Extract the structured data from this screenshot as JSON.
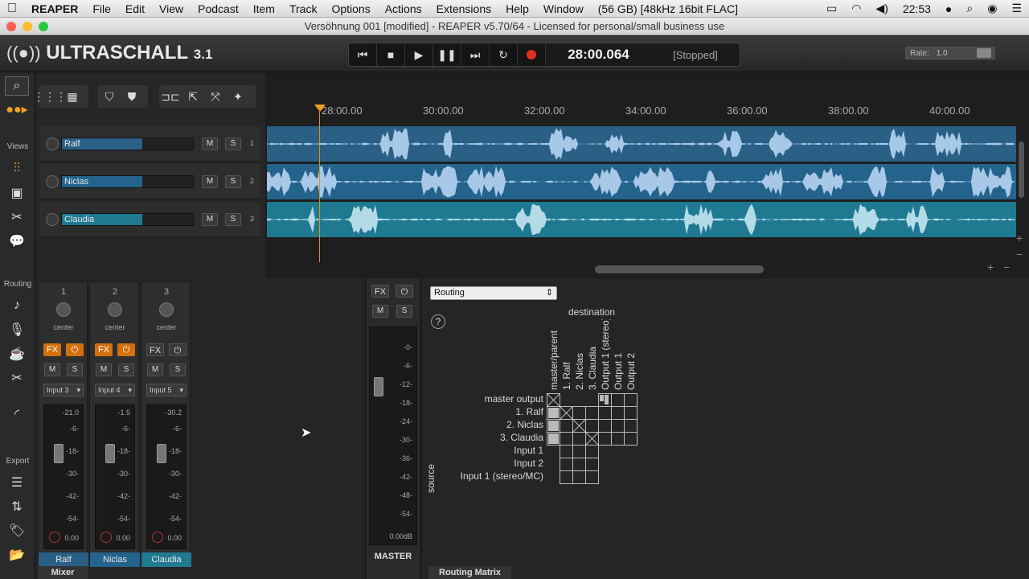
{
  "menubar": {
    "apple": "",
    "app": "REAPER",
    "items": [
      "File",
      "Edit",
      "View",
      "Podcast",
      "Item",
      "Track",
      "Options",
      "Actions",
      "Extensions",
      "Help",
      "Window"
    ],
    "status": "(56 GB) [48kHz 16bit FLAC]",
    "clock": "22:53"
  },
  "window": {
    "title": "Versöhnung 001 [modified] - REAPER v5.70/64 - Licensed for personal/small business use"
  },
  "header": {
    "logo": "ULTRASCHALL",
    "version": "3.1",
    "time": "28:00.064",
    "status": "[Stopped]",
    "rate_label": "Rate:",
    "rate_value": "1.0"
  },
  "leftbar": {
    "views": "Views",
    "routing": "Routing",
    "export": "Export"
  },
  "tracks": [
    {
      "name": "Ralf",
      "num": "1",
      "color": "#2a5f86"
    },
    {
      "name": "Niclas",
      "num": "2",
      "color": "#23638c"
    },
    {
      "name": "Claudia",
      "num": "3",
      "color": "#1f7a91"
    }
  ],
  "track_buttons": {
    "mute": "M",
    "solo": "S"
  },
  "ruler": {
    "ticks": [
      "28:00.00",
      "30:00.00",
      "32:00.00",
      "34:00.00",
      "36:00.00",
      "38:00.00",
      "40:00.00"
    ]
  },
  "mixer": {
    "tab": "Mixer",
    "strips": [
      {
        "num": "1",
        "pan": "center",
        "input": "Input 3",
        "peak": "-21.0",
        "vol": "0.00",
        "name": "Ralf"
      },
      {
        "num": "2",
        "pan": "center",
        "input": "Input 4",
        "peak": "-1.5",
        "vol": "0.00",
        "name": "Niclas"
      },
      {
        "num": "3",
        "pan": "center",
        "input": "Input 5",
        "peak": "-30.2",
        "vol": "0.00",
        "name": "Claudia"
      }
    ],
    "fx": "FX",
    "scale": [
      "-6-",
      "-18-",
      "-30-",
      "-42-",
      "-54-"
    ],
    "master": {
      "name": "MASTER",
      "vol": "0.00dB",
      "scale": [
        "-0-",
        "-6-",
        "-12-",
        "-18-",
        "-24-",
        "-30-",
        "-36-",
        "-42-",
        "-48-",
        "-54-"
      ]
    }
  },
  "routing": {
    "tab": "Routing Matrix",
    "select": "Routing",
    "help": "?",
    "destination": "destination",
    "source": "source",
    "dest_cols": [
      "master/parent",
      "1. Ralf",
      "2. Niclas",
      "3. Claudia",
      "Output 1 (stereo)",
      "Output 1",
      "Output 2"
    ],
    "rows": [
      "master output",
      "1. Ralf",
      "2. Niclas",
      "3. Claudia",
      "Input 1",
      "Input 2",
      "Input 1 (stereo/MC)"
    ]
  }
}
